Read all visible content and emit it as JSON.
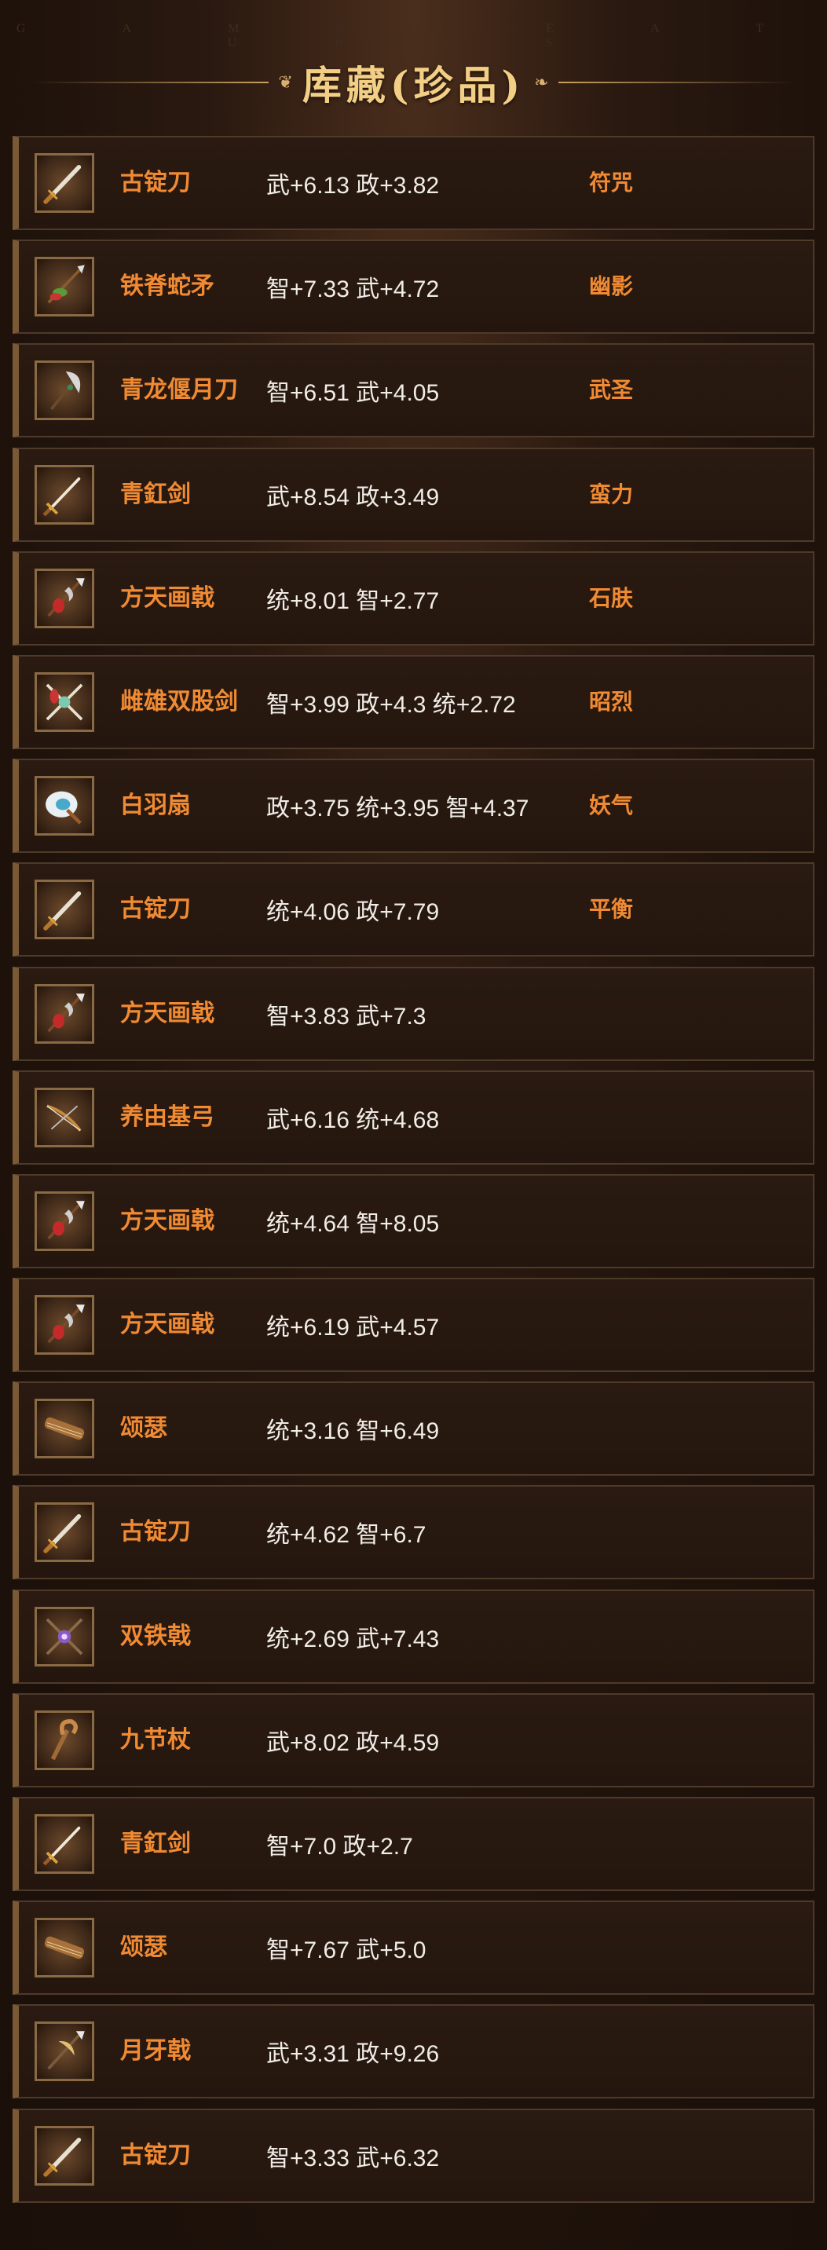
{
  "header": {
    "faint_text": "G A M E   F E A T U R E S",
    "title": "库藏(珍品)"
  },
  "colors": {
    "name": "#f08a33",
    "stats": "#f0ece6",
    "skill": "#f08a33",
    "title": "#f3cf86"
  },
  "items": [
    {
      "icon": "blade-icon",
      "name": "古锭刀",
      "stats": "武+6.13 政+3.82",
      "skill": "符咒"
    },
    {
      "icon": "spear-icon",
      "name": "铁脊蛇矛",
      "stats": "智+7.33 武+4.72",
      "skill": "幽影"
    },
    {
      "icon": "glaive-icon",
      "name": "青龙偃月刀",
      "stats": "智+6.51 武+4.05",
      "skill": "武圣"
    },
    {
      "icon": "sword-icon",
      "name": "青釭剑",
      "stats": "武+8.54 政+3.49",
      "skill": "蛮力"
    },
    {
      "icon": "halberd-icon",
      "name": "方天画戟",
      "stats": "统+8.01 智+2.77",
      "skill": "石肤"
    },
    {
      "icon": "twin-swords-icon",
      "name": "雌雄双股剑",
      "stats": "智+3.99 政+4.3 统+2.72",
      "skill": "昭烈"
    },
    {
      "icon": "feather-fan-icon",
      "name": "白羽扇",
      "stats": "政+3.75 统+3.95 智+4.37",
      "skill": "妖气"
    },
    {
      "icon": "blade-icon",
      "name": "古锭刀",
      "stats": "统+4.06 政+7.79",
      "skill": "平衡"
    },
    {
      "icon": "halberd-icon",
      "name": "方天画戟",
      "stats": "智+3.83 武+7.3",
      "skill": ""
    },
    {
      "icon": "bow-icon",
      "name": "养由基弓",
      "stats": "武+6.16 统+4.68",
      "skill": ""
    },
    {
      "icon": "halberd-icon",
      "name": "方天画戟",
      "stats": "统+4.64 智+8.05",
      "skill": ""
    },
    {
      "icon": "halberd-icon",
      "name": "方天画戟",
      "stats": "统+6.19 武+4.57",
      "skill": ""
    },
    {
      "icon": "zither-icon",
      "name": "颂瑟",
      "stats": "统+3.16 智+6.49",
      "skill": ""
    },
    {
      "icon": "blade-icon",
      "name": "古锭刀",
      "stats": "统+4.62 智+6.7",
      "skill": ""
    },
    {
      "icon": "double-halberd-icon",
      "name": "双铁戟",
      "stats": "统+2.69 武+7.43",
      "skill": ""
    },
    {
      "icon": "staff-icon",
      "name": "九节杖",
      "stats": "武+8.02 政+4.59",
      "skill": ""
    },
    {
      "icon": "sword-icon",
      "name": "青釭剑",
      "stats": "智+7.0 政+2.7",
      "skill": ""
    },
    {
      "icon": "zither-icon",
      "name": "颂瑟",
      "stats": "智+7.67 武+5.0",
      "skill": ""
    },
    {
      "icon": "crescent-halberd-icon",
      "name": "月牙戟",
      "stats": "武+3.31 政+9.26",
      "skill": ""
    },
    {
      "icon": "blade-icon",
      "name": "古锭刀",
      "stats": "智+3.33 武+6.32",
      "skill": ""
    }
  ]
}
